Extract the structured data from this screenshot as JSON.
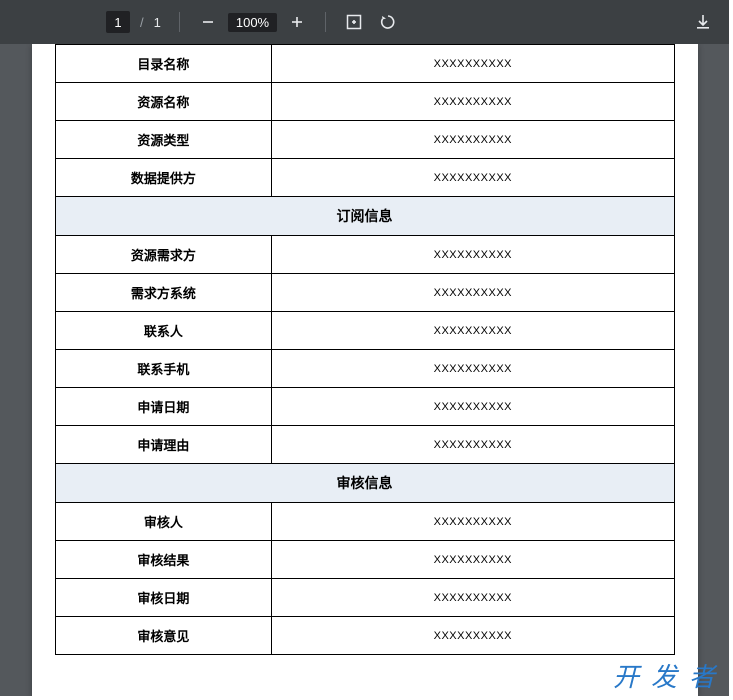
{
  "toolbar": {
    "current_page": "1",
    "page_separator": "/",
    "total_pages": "1",
    "zoom_level": "100%"
  },
  "sections": {
    "basic": {
      "rows": [
        {
          "label": "目录名称",
          "value": "XXXXXXXXXX"
        },
        {
          "label": "资源名称",
          "value": "XXXXXXXXXX"
        },
        {
          "label": "资源类型",
          "value": "XXXXXXXXXX"
        },
        {
          "label": "数据提供方",
          "value": "XXXXXXXXXX"
        }
      ]
    },
    "subscribe": {
      "header": "订阅信息",
      "rows": [
        {
          "label": "资源需求方",
          "value": "XXXXXXXXXX"
        },
        {
          "label": "需求方系统",
          "value": "XXXXXXXXXX"
        },
        {
          "label": "联系人",
          "value": "XXXXXXXXXX"
        },
        {
          "label": "联系手机",
          "value": "XXXXXXXXXX"
        },
        {
          "label": "申请日期",
          "value": "XXXXXXXXXX"
        },
        {
          "label": "申请理由",
          "value": "XXXXXXXXXX"
        }
      ]
    },
    "audit": {
      "header": "审核信息",
      "rows": [
        {
          "label": "审核人",
          "value": "XXXXXXXXXX"
        },
        {
          "label": "审核结果",
          "value": "XXXXXXXXXX"
        },
        {
          "label": "审核日期",
          "value": "XXXXXXXXXX"
        },
        {
          "label": "审核意见",
          "value": "XXXXXXXXXX"
        }
      ]
    }
  },
  "watermark": "开发者"
}
